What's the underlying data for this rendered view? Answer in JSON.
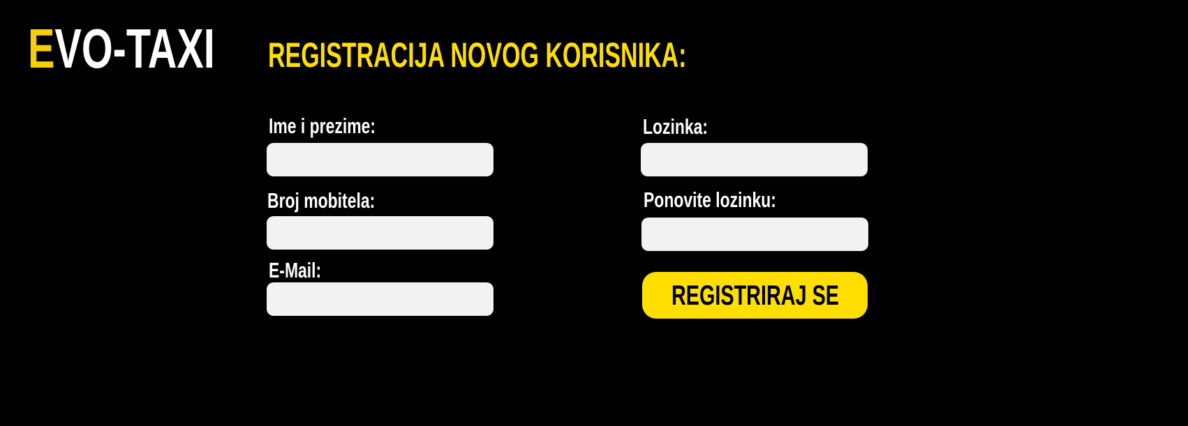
{
  "brand": {
    "logo_first_letter": "E",
    "logo_rest": "VO-TAXI",
    "accent_color": "#ffde00",
    "background_color": "#000000"
  },
  "page": {
    "title": "REGISTRACIJA NOVOG KORISNIKA:"
  },
  "form": {
    "full_name": {
      "label": "Ime i prezime:",
      "value": ""
    },
    "mobile": {
      "label": "Broj mobitela:",
      "value": ""
    },
    "email": {
      "label": "E-Mail:",
      "value": ""
    },
    "password": {
      "label": "Lozinka:",
      "value": ""
    },
    "password_repeat": {
      "label": "Ponovite lozinku:",
      "value": ""
    },
    "submit_label": "REGISTRIRAJ SE"
  }
}
